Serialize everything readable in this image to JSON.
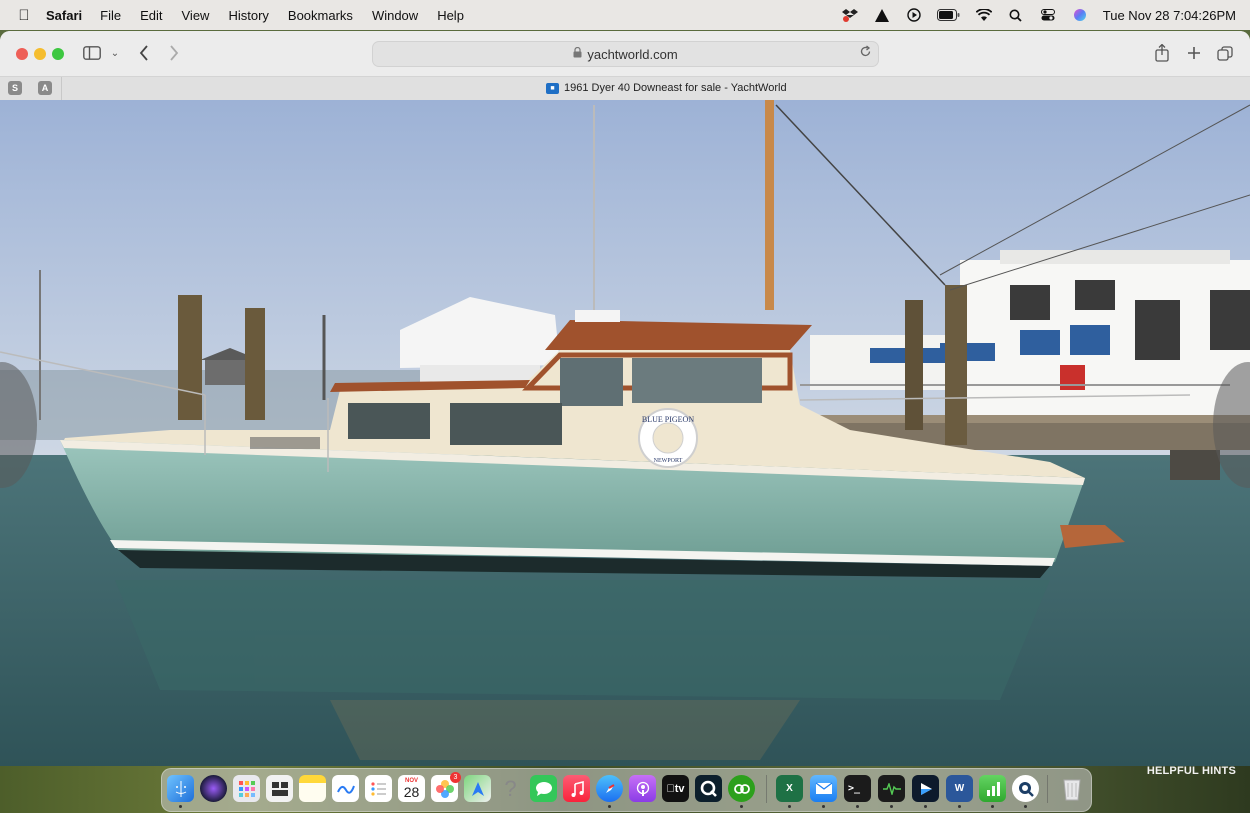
{
  "menubar": {
    "app_name": "Safari",
    "items": [
      "File",
      "Edit",
      "View",
      "History",
      "Bookmarks",
      "Window",
      "Help"
    ],
    "clock": "Tue Nov 28  7:04:26PM"
  },
  "toolbar": {
    "address": "yachtworld.com"
  },
  "tabs": {
    "pinned": [
      "S",
      "A"
    ],
    "active_title": "1961 Dyer 40 Downeast for sale - YachtWorld"
  },
  "gallery": {
    "life_ring_text_1": "BLUE PIGEON",
    "life_ring_text_2": "NEWPORT"
  },
  "dock": {
    "calendar_month": "NOV",
    "calendar_day": "28",
    "photos_badge": "3",
    "tv_label": "tv",
    "excel_label": "X",
    "word_label": "W"
  },
  "desktop": {
    "hints_label": "HELPFUL HINTS"
  },
  "colors": {
    "hull": "#8fbcb2",
    "cabin_trim": "#a0522d",
    "deck": "#efe6d0",
    "water": "#3f6f73"
  }
}
